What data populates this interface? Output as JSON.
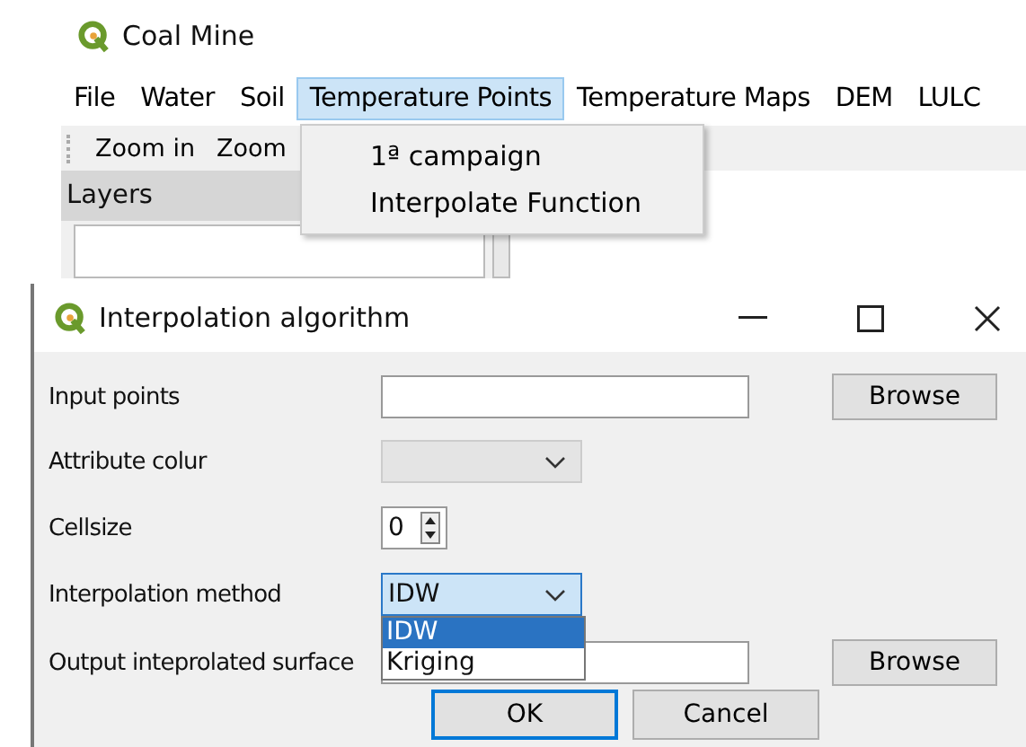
{
  "main_window": {
    "title": "Coal Mine",
    "menu": [
      {
        "label": "File",
        "selected": false
      },
      {
        "label": "Water",
        "selected": false
      },
      {
        "label": "Soil",
        "selected": false
      },
      {
        "label": "Temperature Points",
        "selected": true
      },
      {
        "label": "Temperature Maps",
        "selected": false
      },
      {
        "label": "DEM",
        "selected": false
      },
      {
        "label": "LULC",
        "selected": false
      }
    ],
    "open_menu": [
      "1ª campaign",
      "Interpolate Function"
    ],
    "toolbar": [
      "Zoom in",
      "Zoom"
    ],
    "layers_panel": {
      "title": "Layers"
    }
  },
  "dialog": {
    "title": "Interpolation algorithm",
    "fields": [
      {
        "kind": "file",
        "label": "Input points",
        "button": "Browse"
      },
      {
        "kind": "combo",
        "label": "Attribute colur",
        "disabled": true,
        "expanded": false
      },
      {
        "kind": "spin",
        "label": "Cellsize",
        "value": "0"
      },
      {
        "kind": "combo",
        "label": "Interpolation method",
        "value": "IDW",
        "disabled": false,
        "expanded": true,
        "options": [
          {
            "label": "IDW",
            "selected": true
          },
          {
            "label": "Kriging",
            "selected": false
          }
        ]
      },
      {
        "kind": "file",
        "label": "Output inteprolated surface",
        "button": "Browse"
      }
    ],
    "buttons": [
      {
        "label": "OK",
        "default": true
      },
      {
        "label": "Cancel",
        "default": false
      }
    ]
  }
}
